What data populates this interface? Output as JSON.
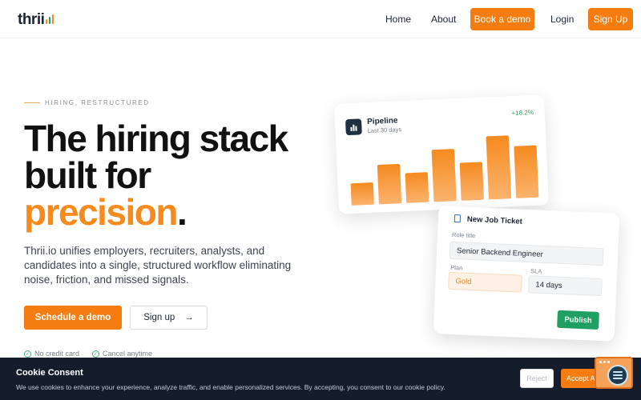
{
  "brand": {
    "name": "thrii",
    "bar_colors": [
      "#f58a1f",
      "#25a05a",
      "#f58a1f"
    ]
  },
  "nav": {
    "home": "Home",
    "about": "About",
    "book_demo": "Book a demo",
    "login": "Login",
    "signup": "Sign Up"
  },
  "hero": {
    "eyebrow": "HIRING, RESTRUCTURED",
    "headline_line1": "The hiring stack",
    "headline_line2": "built for",
    "headline_accent": "precision",
    "headline_period": ".",
    "subtext": "Thrii.io unifies employers, recruiters, analysts, and candidates into a single, structured workflow eliminating noise, friction, and missed signals.",
    "cta_primary": "Schedule a demo",
    "cta_secondary": "Sign up",
    "cta_secondary_icon": "→",
    "perks": [
      "No credit card",
      "Cancel anytime"
    ]
  },
  "pipeline_card": {
    "title": "Pipeline",
    "subtitle": "Last 30 days",
    "growth": "+18.2%",
    "chart_data": {
      "type": "bar",
      "values": [
        28,
        50,
        38,
        66,
        48,
        80,
        66
      ],
      "ylim": [
        0,
        85
      ]
    }
  },
  "ticket_card": {
    "title": "New Job Ticket",
    "role_label": "Role title",
    "role_value": "Senior Backend Engineer",
    "plan_label": "Plan",
    "plan_value": "Gold",
    "sla_label": "SLA",
    "sla_value": "14 days",
    "publish": "Publish"
  },
  "cookie": {
    "title": "Cookie Consent",
    "text": "We use cookies to enhance your experience, analyze traffic, and enable personalized services. By accepting, you consent to our cookie policy.",
    "reject": "Reject",
    "accept": "Accept All"
  },
  "colors": {
    "accent": "#f57c10",
    "success": "#1f9f62",
    "dark": "#151d2c"
  }
}
